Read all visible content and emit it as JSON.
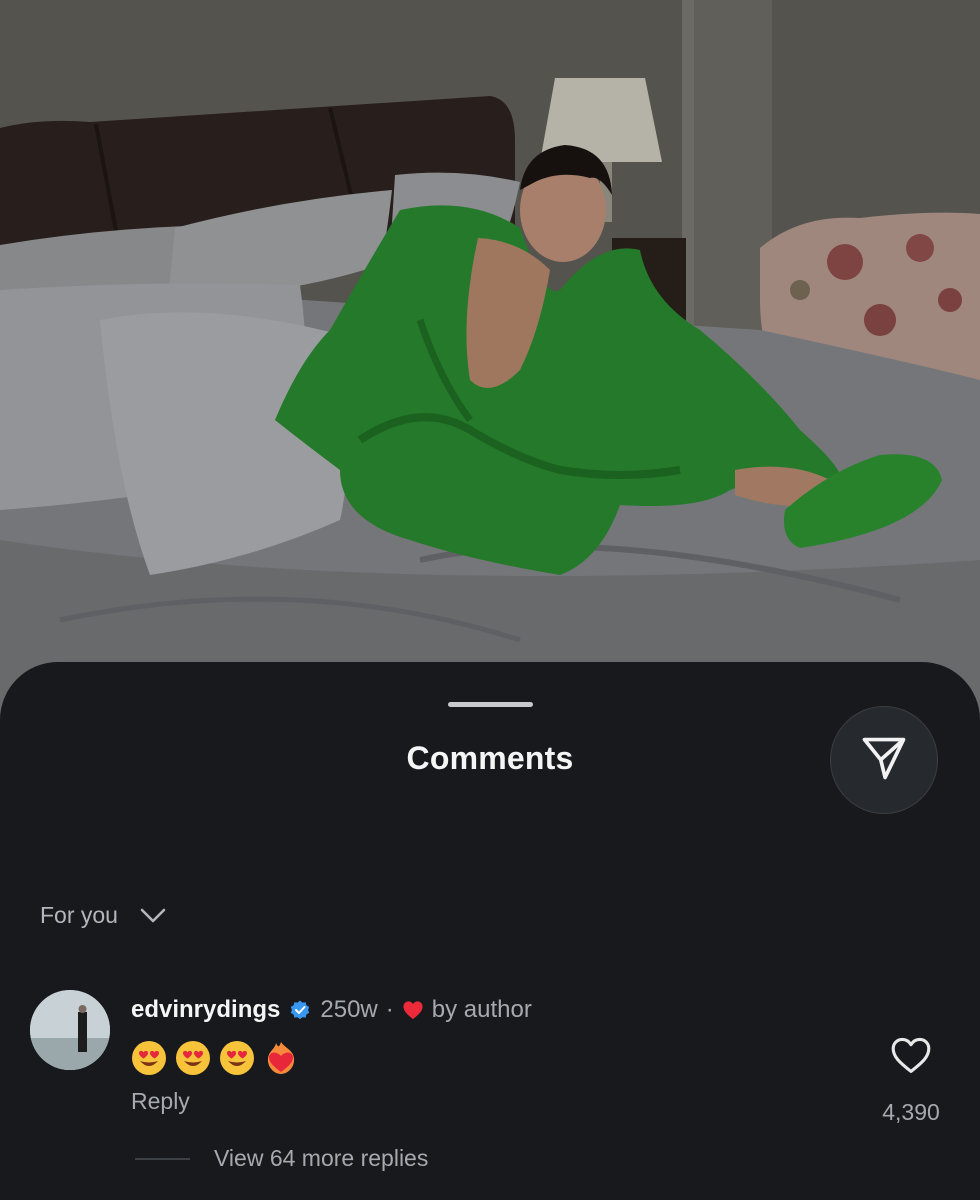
{
  "sheet": {
    "title": "Comments"
  },
  "icons": {
    "share": "share-send-icon",
    "sort_toggle": "chevron-down-icon",
    "verified": "verified-badge-icon",
    "liked_by_author": "heart-filled-icon",
    "like": "heart-outline-icon"
  },
  "sort": {
    "label": "For you"
  },
  "comment": {
    "username": "edvinrydings",
    "age": "250w",
    "separator": "·",
    "author_like_label": "by author",
    "emojis": [
      "😍",
      "😍",
      "😍",
      "❤️‍🔥"
    ],
    "reply_label": "Reply",
    "like_count": "4,390",
    "view_replies_label": "View 64 more replies"
  },
  "colors": {
    "sheet_bg": "#17191c",
    "verified_blue": "#3897f0",
    "author_heart_red": "#ed2a3a",
    "secondary_text": "#a6a9ad"
  }
}
